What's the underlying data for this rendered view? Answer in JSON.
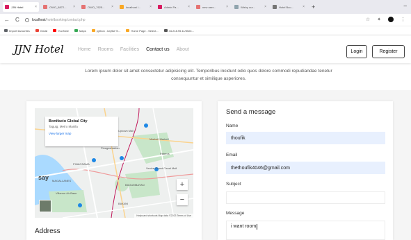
{
  "browser": {
    "tabs": [
      {
        "label": "JJN Hotel",
        "color": "#d81b60",
        "active": true
      },
      {
        "label": "OWO_8872...",
        "color": "#e57373"
      },
      {
        "label": "OWO_7625...",
        "color": "#e57373"
      },
      {
        "label": "localhost /...",
        "color": "#f9a825"
      },
      {
        "label": "Admin Pa...",
        "color": "#d81b60"
      },
      {
        "label": "new user...",
        "color": "#e57373"
      },
      {
        "label": "Wishy our...",
        "color": "#90a4ae"
      },
      {
        "label": "Hotel Boo...",
        "color": "#757575"
      }
    ],
    "new_tab": "+",
    "window_controls": "–",
    "back": "←",
    "reload": "C",
    "url_host": "localhost",
    "url_path": "/hotelbooking/contact.php",
    "star": "☆",
    "extensions": "✦",
    "menu": "⋮",
    "bookmarks": [
      {
        "label": "Import favourites",
        "color": "#5f6368"
      },
      {
        "label": "Gmail",
        "color": "#ea4335"
      },
      {
        "label": "YouTube",
        "color": "#ff0000"
      },
      {
        "label": "Maps",
        "color": "#34a853"
      },
      {
        "label": "python - keylist %...",
        "color": "#f9a825"
      },
      {
        "label": "Home Page - Select...",
        "color": "#f9a825"
      },
      {
        "label": "44.218.95.11/5524...",
        "color": "#555555"
      }
    ]
  },
  "site": {
    "brand": "JJN Hotel",
    "menu": [
      "Home",
      "Rooms",
      "Facilities",
      "Contact us",
      "About"
    ],
    "active_menu": "Contact us",
    "login_label": "Login",
    "register_label": "Register",
    "intro": "Lorem ipsum dolor sit amet consectetur adipisicing elit. Temporibus incidunt odio quos dolore commodi repudiandae tenetur consequuntur et similique asperiores."
  },
  "map": {
    "place_title": "Bonifacio Global City",
    "place_subtitle": "Taguig, Metro Manila",
    "place_link": "View larger map",
    "labels": [
      "Uptown Mall",
      "Market! Market!",
      "Pinagsamahan",
      "Pateros",
      "MAGALLANES",
      "Venice Grand Canal Mall",
      "Villamor Air Base",
      "PINAGSAMA",
      "BAGUMBAYAN",
      "BAYANI"
    ],
    "big_label": "say",
    "zoom_in": "+",
    "zoom_out": "−",
    "footer": "Keyboard shortcuts  Map data ©2023  Terms of Use"
  },
  "address_title": "Address",
  "form": {
    "title": "Send a message",
    "name_label": "Name",
    "name_value": "thoufik",
    "email_label": "Email",
    "email_value": "thethoufik4046@gmail.com",
    "subject_label": "Subject",
    "subject_value": "",
    "message_label": "Message",
    "message_value": "i want room"
  },
  "colors": {
    "autofill": "#e8f0fe",
    "map_water": "#aadaff",
    "map_green": "#c8e6c9"
  }
}
